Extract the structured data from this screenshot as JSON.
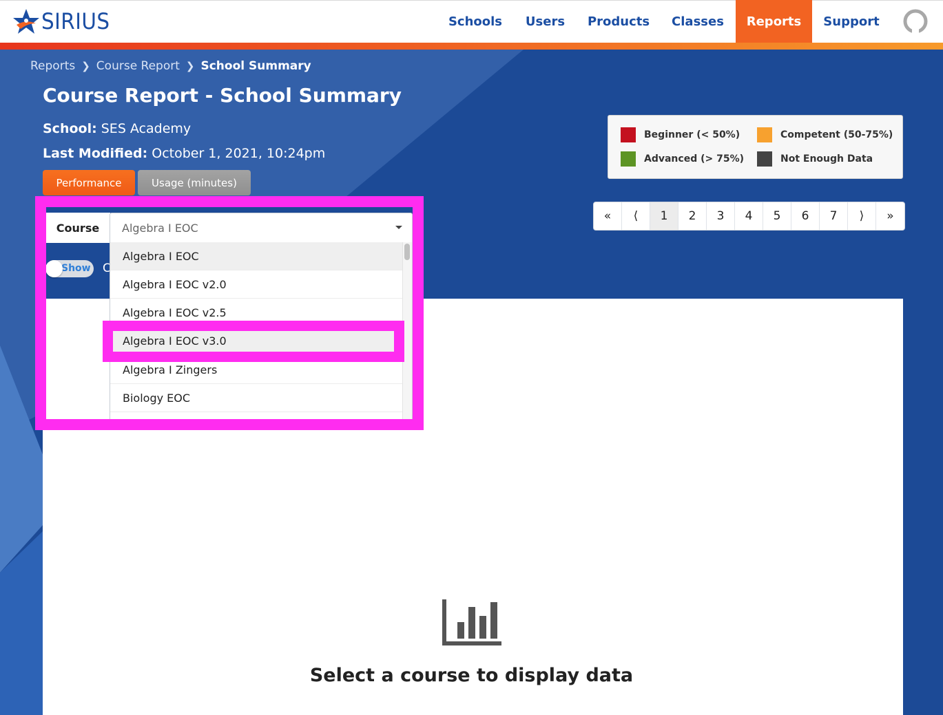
{
  "brand": {
    "name": "SIRIUS"
  },
  "nav": {
    "items": [
      {
        "label": "Schools"
      },
      {
        "label": "Users"
      },
      {
        "label": "Products"
      },
      {
        "label": "Classes"
      },
      {
        "label": "Reports"
      },
      {
        "label": "Support"
      }
    ],
    "active": "Reports"
  },
  "breadcrumb": [
    {
      "label": "Reports"
    },
    {
      "label": "Course Report"
    },
    {
      "label": "School Summary"
    }
  ],
  "page": {
    "title": "Course Report - School Summary",
    "school_label": "School:",
    "school_value": "SES Academy",
    "modified_label": "Last Modified:",
    "modified_value": "October 1, 2021, 10:24pm"
  },
  "tabs": [
    {
      "label": "Performance",
      "active": true
    },
    {
      "label": "Usage (minutes)",
      "active": false
    }
  ],
  "legend": [
    {
      "label": "Beginner (< 50%)",
      "color": "#c4111f"
    },
    {
      "label": "Competent (50-75%)",
      "color": "#f7a12f"
    },
    {
      "label": "Advanced (> 75%)",
      "color": "#5d9424"
    },
    {
      "label": "Not Enough Data",
      "color": "#444444"
    }
  ],
  "pagination": {
    "first": "«",
    "prev": "⟨",
    "pages": [
      "1",
      "2",
      "3",
      "4",
      "5",
      "6",
      "7"
    ],
    "current": "1",
    "next": "⟩",
    "last": "»"
  },
  "filter": {
    "course_label": "Course",
    "course_selected": "Algebra I EOC",
    "options": [
      "Algebra I EOC",
      "Algebra I EOC v2.0",
      "Algebra I EOC v2.5",
      "Algebra I EOC v3.0",
      "Algebra I Zingers",
      "Biology EOC"
    ],
    "highlighted_option": "Algebra I EOC v3.0",
    "toggle_label": "Show",
    "truncated_label": "C"
  },
  "empty_state": {
    "icon": "bar-chart-icon",
    "message": "Select a course to display data"
  },
  "colors": {
    "brand_blue": "#1b4ea3",
    "accent_orange": "#f26322",
    "page_bg": "#1c4a96",
    "annotation_magenta": "#ff2cf0"
  }
}
